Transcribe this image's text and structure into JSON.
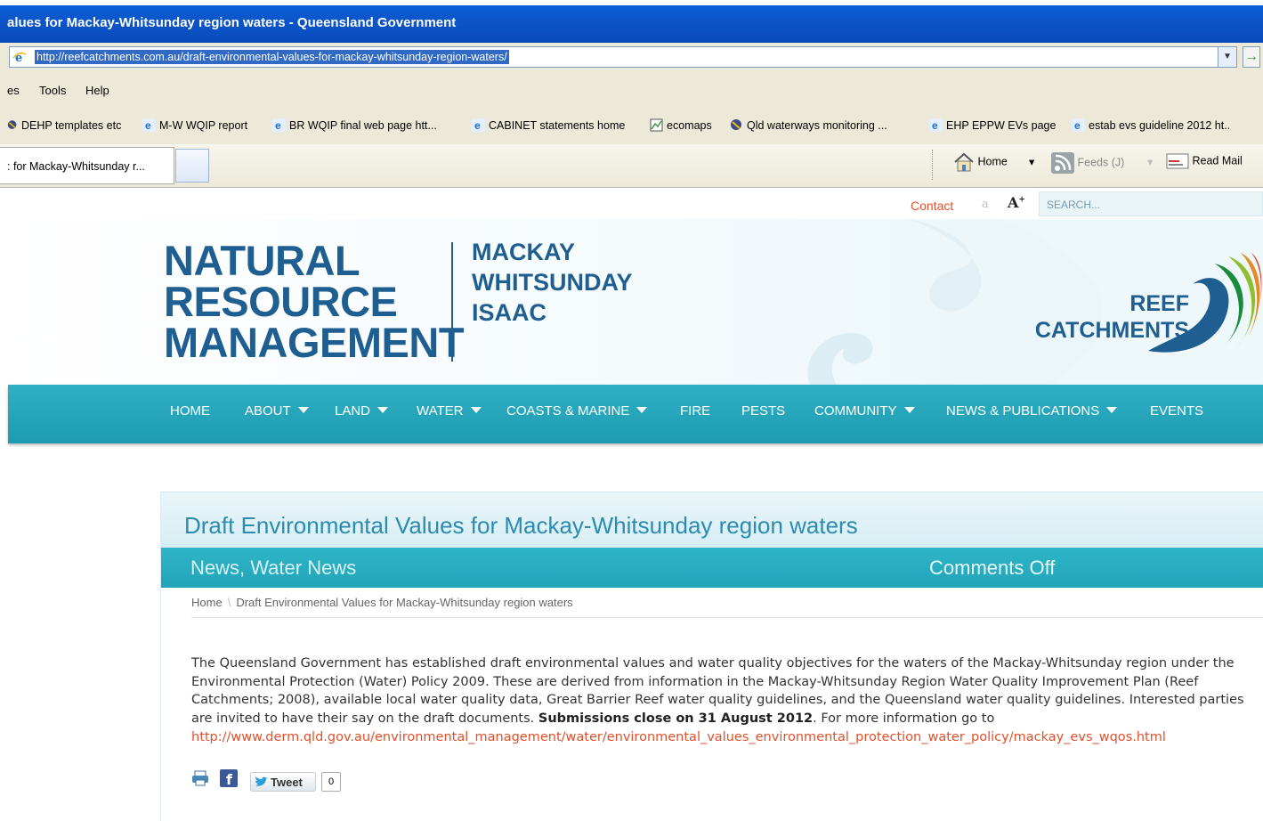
{
  "browser": {
    "window_title": "alues for Mackay-Whitsunday region waters - Queensland Government",
    "address_url": "http://reefcatchments.com.au/draft-environmental-values-for-mackay-whitsunday-region-waters/",
    "menu": [
      "es",
      "Tools",
      "Help"
    ],
    "favorites": [
      "DEHP templates etc",
      "M-W WQIP report",
      "BR WQIP final web page htt...",
      "CABINET statements home",
      "ecomaps",
      "Qld waterways monitoring ...",
      "EHP EPPW EVs page",
      "estab evs guideline 2012 ht.."
    ],
    "tab_label": ": for Mackay-Whitsunday r...",
    "toolbar": {
      "home": "Home",
      "feeds": "Feeds (J)",
      "read_mail": "Read Mail"
    }
  },
  "site": {
    "contact": "Contact",
    "font_small": "a",
    "font_large": "A",
    "search_placeholder": "SEARCH...",
    "logo_lines": [
      "NATURAL",
      "RESOURCE",
      "MANAGEMENT"
    ],
    "region_lines": [
      "MACKAY",
      "WHITSUNDAY",
      "ISAAC"
    ],
    "partner_lines": [
      "REEF",
      "CATCHMENTS"
    ],
    "nav": [
      {
        "label": "HOME",
        "dropdown": false
      },
      {
        "label": "ABOUT",
        "dropdown": true
      },
      {
        "label": "LAND",
        "dropdown": true
      },
      {
        "label": "WATER",
        "dropdown": true
      },
      {
        "label": "COASTS & MARINE",
        "dropdown": true
      },
      {
        "label": "FIRE",
        "dropdown": false
      },
      {
        "label": "PESTS",
        "dropdown": false
      },
      {
        "label": "COMMUNITY",
        "dropdown": true
      },
      {
        "label": "NEWS & PUBLICATIONS",
        "dropdown": true
      },
      {
        "label": "EVENTS",
        "dropdown": false
      }
    ],
    "colors": {
      "accent": "#e0502b",
      "nav": "#22a4b9",
      "brand": "#1f5e91"
    }
  },
  "post": {
    "title": "Draft Environmental Values for Mackay-Whitsunday region waters",
    "categories": "News, Water News",
    "comments": "Comments Off",
    "breadcrumb": [
      "Home",
      "Draft Environmental Values for Mackay-Whitsunday region waters"
    ],
    "body_before": "The Queensland Government has established draft environmental values and water quality objectives for the waters of the Mackay-Whitsunday region under the Environmental Protection (Water) Policy 2009. These are derived from information in the Mackay-Whitsunday Region Water Quality Improvement Plan (Reef Catchments; 2008), available local water quality data, Great Barrier Reef water quality guidelines, and the Queensland water quality guidelines. Interested parties are invited to have their say on the draft documents.",
    "body_bold": "Submissions close on 31 August 2012",
    "body_after": ". For more information go to",
    "link": "http://www.derm.qld.gov.au/environmental_management/water/environmental_values_environmental_protection_water_policy/mackay_evs_wqos.html",
    "share": {
      "tweet": "Tweet",
      "tweet_count": "0"
    }
  }
}
